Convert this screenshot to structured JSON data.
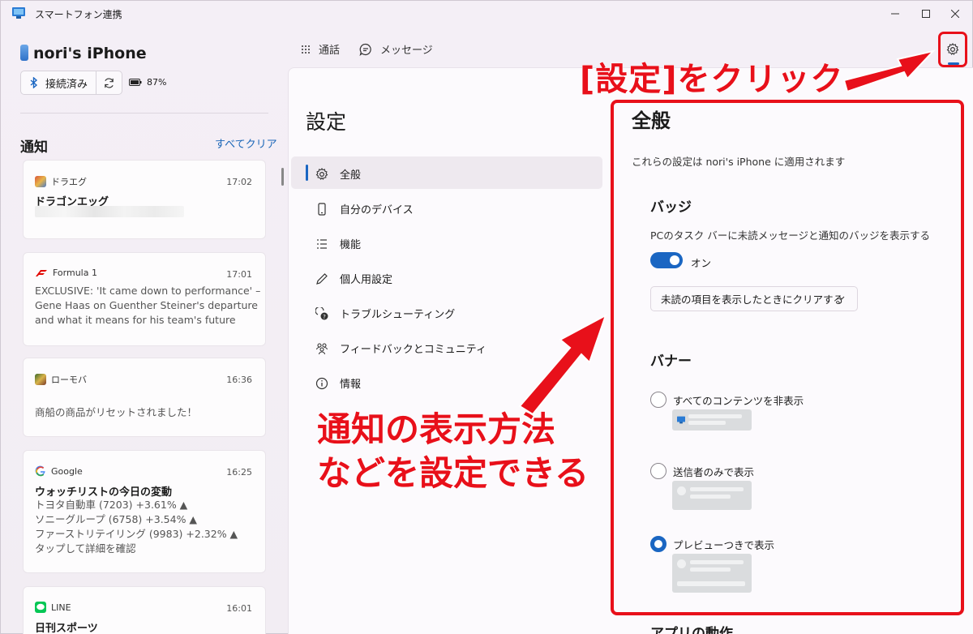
{
  "app": {
    "title": "スマートフォン連携"
  },
  "device": {
    "name": "nori's iPhone",
    "status": "接続済み",
    "battery": "87%"
  },
  "notifications": {
    "title": "通知",
    "clear_all": "すべてクリア",
    "items": [
      {
        "app": "ドラエグ",
        "time": "17:02",
        "title": "ドラゴンエッグ",
        "body": ""
      },
      {
        "app": "Formula 1",
        "time": "17:01",
        "title": "",
        "body": "EXCLUSIVE: 'It came down to performance' – Gene Haas on Guenther Steiner's departure and what it means for his team's future"
      },
      {
        "app": "ローモバ",
        "time": "16:36",
        "title": "",
        "body": "商船の商品がリセットされました！"
      },
      {
        "app": "Google",
        "time": "16:25",
        "title": "ウォッチリストの今日の変動",
        "body": "トヨタ自動車 (7203) +3.61% ▲\nソニーグループ (6758) +3.54% ▲\nファーストリテイリング (9983) +2.32% ▲\nタップして詳細を確認"
      },
      {
        "app": "LINE",
        "time": "16:01",
        "title": "日刊スポーツ",
        "body": ""
      }
    ]
  },
  "tabs": {
    "calls": "通話",
    "messages": "メッセージ"
  },
  "settings": {
    "title": "設定",
    "nav": [
      {
        "label": "全般",
        "icon": "gear-icon"
      },
      {
        "label": "自分のデバイス",
        "icon": "phone-icon"
      },
      {
        "label": "機能",
        "icon": "list-icon"
      },
      {
        "label": "個人用設定",
        "icon": "pen-icon"
      },
      {
        "label": "トラブルシューティング",
        "icon": "troubleshoot-icon"
      },
      {
        "label": "フィードバックとコミュニティ",
        "icon": "community-icon"
      },
      {
        "label": "情報",
        "icon": "info-icon"
      }
    ],
    "general": {
      "title": "全般",
      "description": "これらの設定は nori's iPhone に適用されます",
      "badge": {
        "title": "バッジ",
        "description": "PCのタスク バーに未読メッセージと通知のバッジを表示する",
        "toggle_label": "オン",
        "dropdown_value": "未読の項目を表示したときにクリアする"
      },
      "banner": {
        "title": "バナー",
        "options": [
          {
            "label": "すべてのコンテンツを非表示",
            "selected": false
          },
          {
            "label": "送信者のみで表示",
            "selected": false
          },
          {
            "label": "プレビューつきで表示",
            "selected": true
          }
        ]
      },
      "next_section": "アプリの動作"
    }
  },
  "annotations": {
    "click_settings": "[設定]をクリック",
    "notify_line1": "通知の表示方法",
    "notify_line2": "などを設定できる"
  },
  "colors": {
    "accent": "#1a66c2",
    "annotation": "#e8101a"
  }
}
